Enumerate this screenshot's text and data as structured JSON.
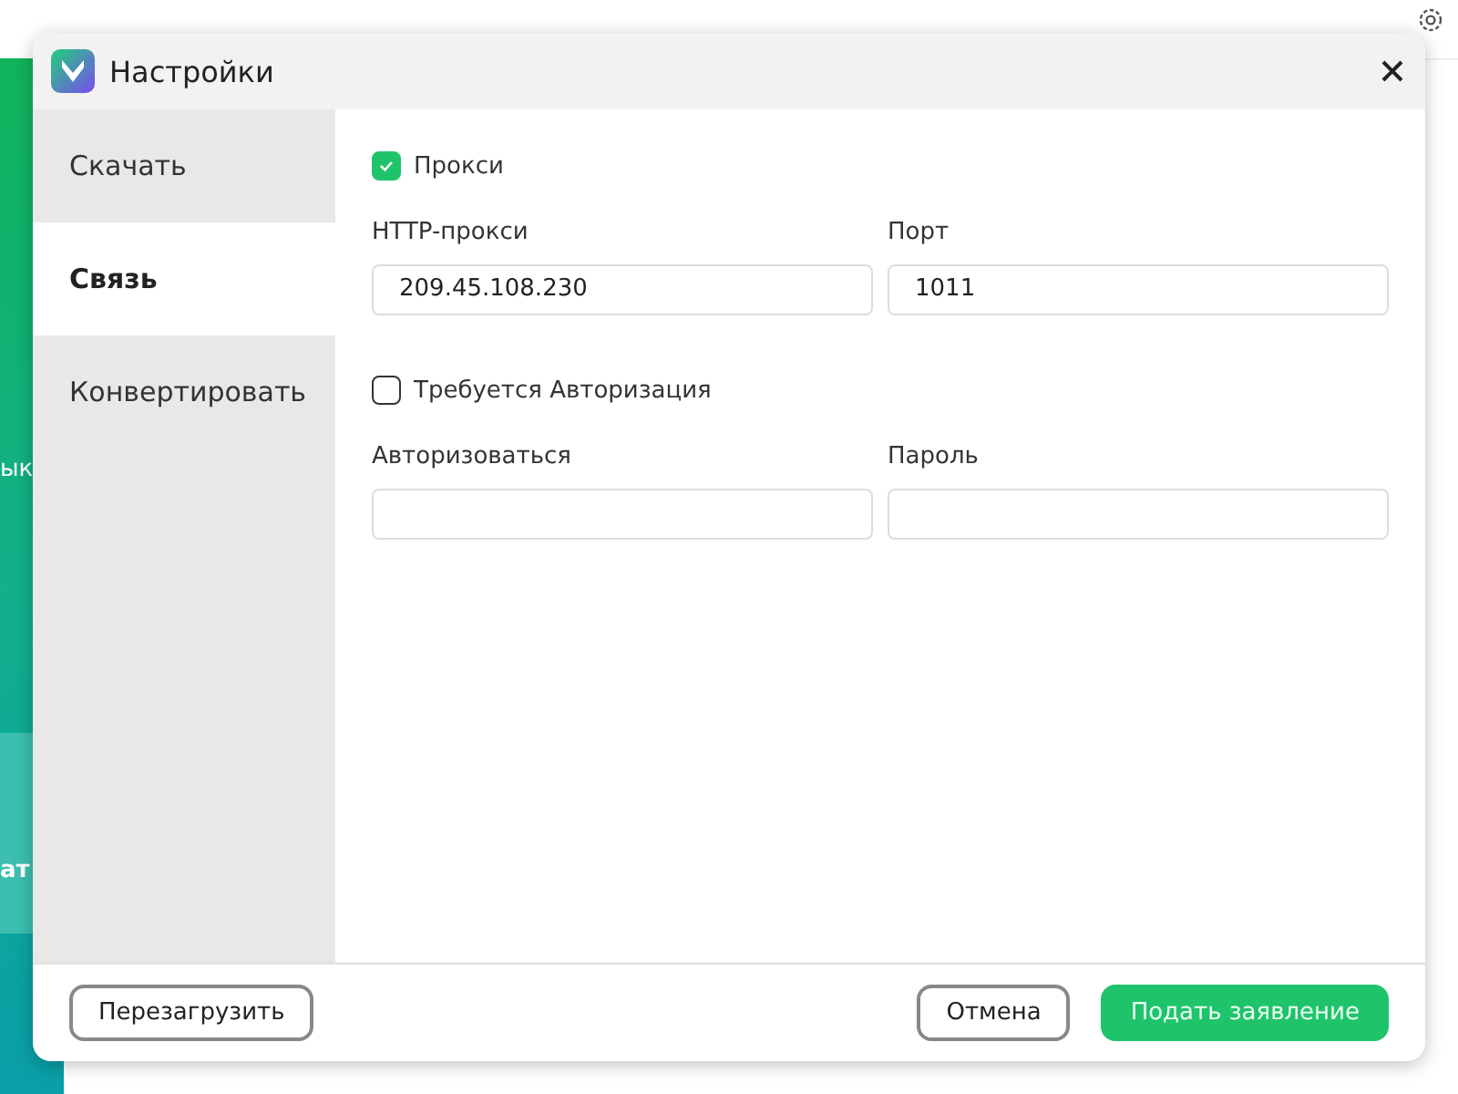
{
  "background": {
    "side_texts": [
      "ык",
      "ат"
    ]
  },
  "window": {
    "title": "Настройки"
  },
  "sidebar": {
    "items": [
      {
        "label": "Скачать",
        "selected": false
      },
      {
        "label": "Связь",
        "selected": true
      },
      {
        "label": "Конвертировать",
        "selected": false
      }
    ]
  },
  "proxy": {
    "checkbox": {
      "label": "Прокси",
      "checked": true
    },
    "fields": [
      {
        "label": "HTTP-прокси",
        "value": "209.45.108.230"
      },
      {
        "label": "Порт",
        "value": "1011"
      }
    ]
  },
  "auth": {
    "checkbox": {
      "label": "Требуется Авторизация",
      "checked": false
    },
    "fields": [
      {
        "label": "Авторизоваться"
      },
      {
        "label": "Пароль"
      }
    ]
  },
  "footer": {
    "reset": "Перезагрузить",
    "cancel": "Отмена",
    "submit": "Подать заявление"
  }
}
